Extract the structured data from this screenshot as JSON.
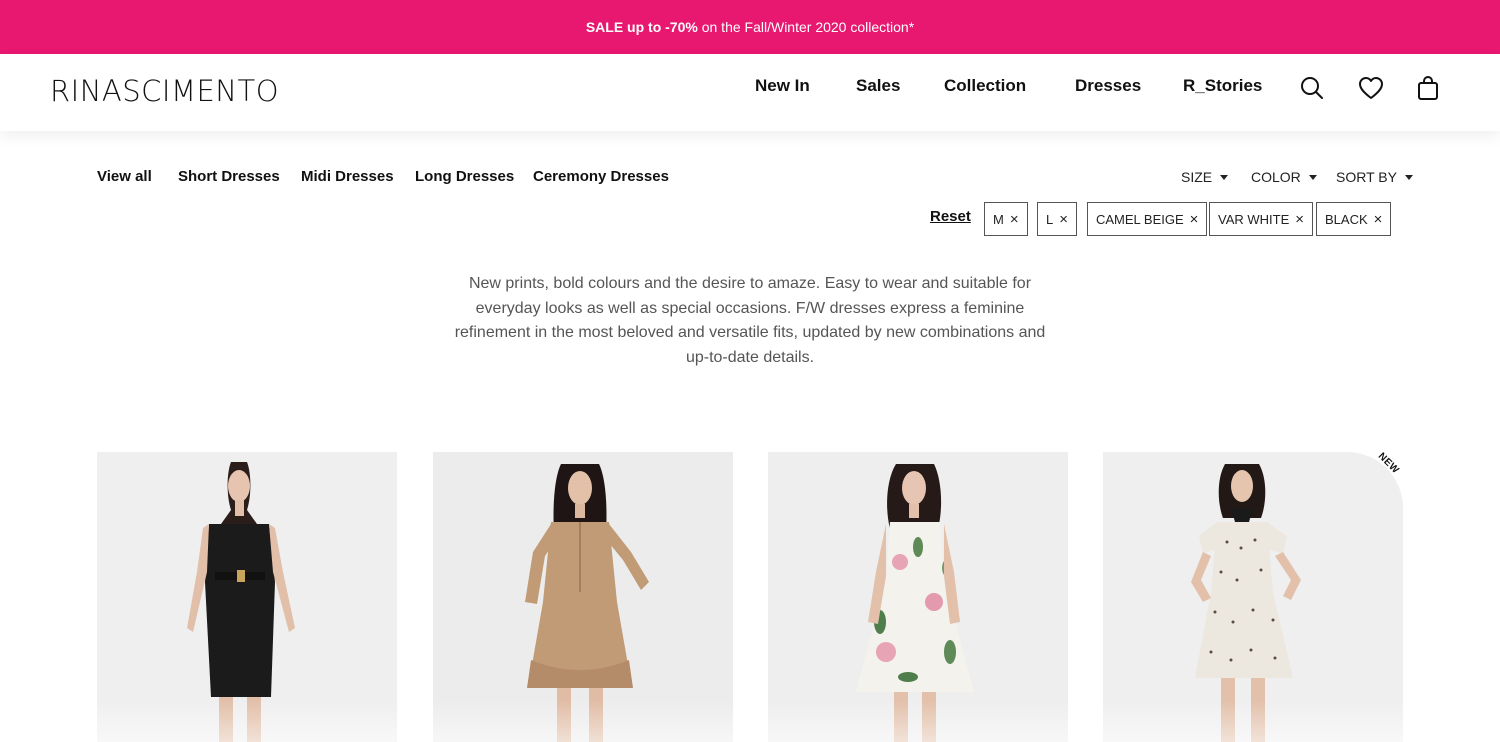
{
  "promo": {
    "prefix": "SALE up to -70%",
    "suffix": " on the Fall/Winter 2020 collection*",
    "bg_color": "#e8176f"
  },
  "header": {
    "logo": "RINASCIMENTO",
    "nav": [
      "New In",
      "Sales",
      "Collection",
      "Dresses",
      "R_Stories"
    ],
    "icons": [
      "search-icon",
      "heart-icon",
      "shopping-bag-icon"
    ]
  },
  "subnav": {
    "items": [
      "View all",
      "Short Dresses",
      "Midi Dresses",
      "Long Dresses",
      "Ceremony Dresses"
    ]
  },
  "filters": {
    "dropdowns": [
      "SIZE",
      "COLOR",
      "SORT BY"
    ],
    "reset_label": "Reset",
    "active": [
      "M",
      "L",
      "CAMEL BEIGE",
      "VAR WHITE",
      "BLACK"
    ]
  },
  "intro": {
    "lines": [
      "New prints, bold colours and the desire to amaze. Easy to wear and suitable for",
      "everyday looks as well as special occasions. F/W dresses express a feminine",
      "refinement in the most beloved and versatile fits, updated by new combinations and",
      "up-to-date details."
    ]
  },
  "products": [
    {
      "dress_color": "#1b1b1b",
      "pattern": "solid"
    },
    {
      "dress_color": "#c19a76",
      "pattern": "solid"
    },
    {
      "dress_color": "#f4f2ec",
      "pattern": "floral"
    },
    {
      "dress_color": "#ede8df",
      "pattern": "dots"
    }
  ],
  "badges": {
    "new": "NEW"
  }
}
